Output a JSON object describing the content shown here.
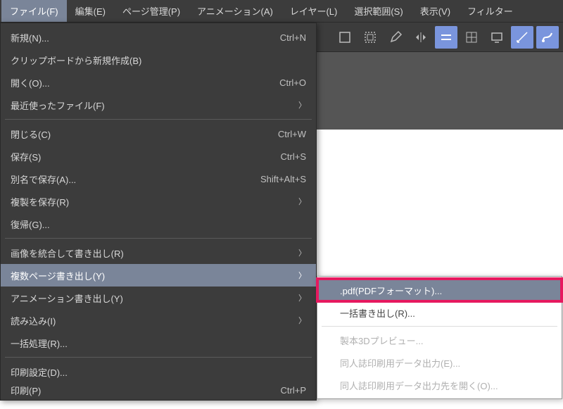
{
  "menubar": {
    "items": [
      "ファイル(F)",
      "編集(E)",
      "ページ管理(P)",
      "アニメーション(A)",
      "レイヤー(L)",
      "選択範囲(S)",
      "表示(V)",
      "フィルター"
    ]
  },
  "toolbar_icons": {
    "i0": "rect",
    "i1": "rect-dash",
    "i2": "pencil",
    "i3": "flip-h",
    "i4": "grid-on",
    "i5": "grid",
    "i6": "monitor",
    "i7": "angle",
    "i8": "brush"
  },
  "file_menu": {
    "items": [
      {
        "label": "新規(N)...",
        "shortcut": "Ctrl+N"
      },
      {
        "label": "クリップボードから新規作成(B)"
      },
      {
        "label": "開く(O)...",
        "shortcut": "Ctrl+O"
      },
      {
        "label": "最近使ったファイル(F)",
        "submenu": true
      },
      {
        "sep": true
      },
      {
        "label": "閉じる(C)",
        "shortcut": "Ctrl+W"
      },
      {
        "label": "保存(S)",
        "shortcut": "Ctrl+S"
      },
      {
        "label": "別名で保存(A)...",
        "shortcut": "Shift+Alt+S"
      },
      {
        "label": "複製を保存(R)",
        "submenu": true
      },
      {
        "label": "復帰(G)..."
      },
      {
        "sep": true
      },
      {
        "label": "画像を統合して書き出し(R)",
        "submenu": true
      },
      {
        "label": "複数ページ書き出し(Y)",
        "submenu": true,
        "highlighted": true
      },
      {
        "label": "アニメーション書き出し(Y)",
        "submenu": true
      },
      {
        "label": "読み込み(I)",
        "submenu": true
      },
      {
        "label": "一括処理(R)..."
      },
      {
        "sep": true
      },
      {
        "label": "印刷設定(D)..."
      },
      {
        "label": "印刷(P)",
        "shortcut": "Ctrl+P"
      }
    ]
  },
  "submenu": {
    "items": [
      {
        "label": ".pdf(PDFフォーマット)...",
        "highlighted": true
      },
      {
        "label": "一括書き出し(R)..."
      },
      {
        "sep": true
      },
      {
        "label": "製本3Dプレビュー...",
        "disabled": true
      },
      {
        "label": "同人誌印刷用データ出力(E)...",
        "disabled": true
      },
      {
        "label": "同人誌印刷用データ出力先を開く(O)...",
        "disabled": true
      }
    ]
  }
}
